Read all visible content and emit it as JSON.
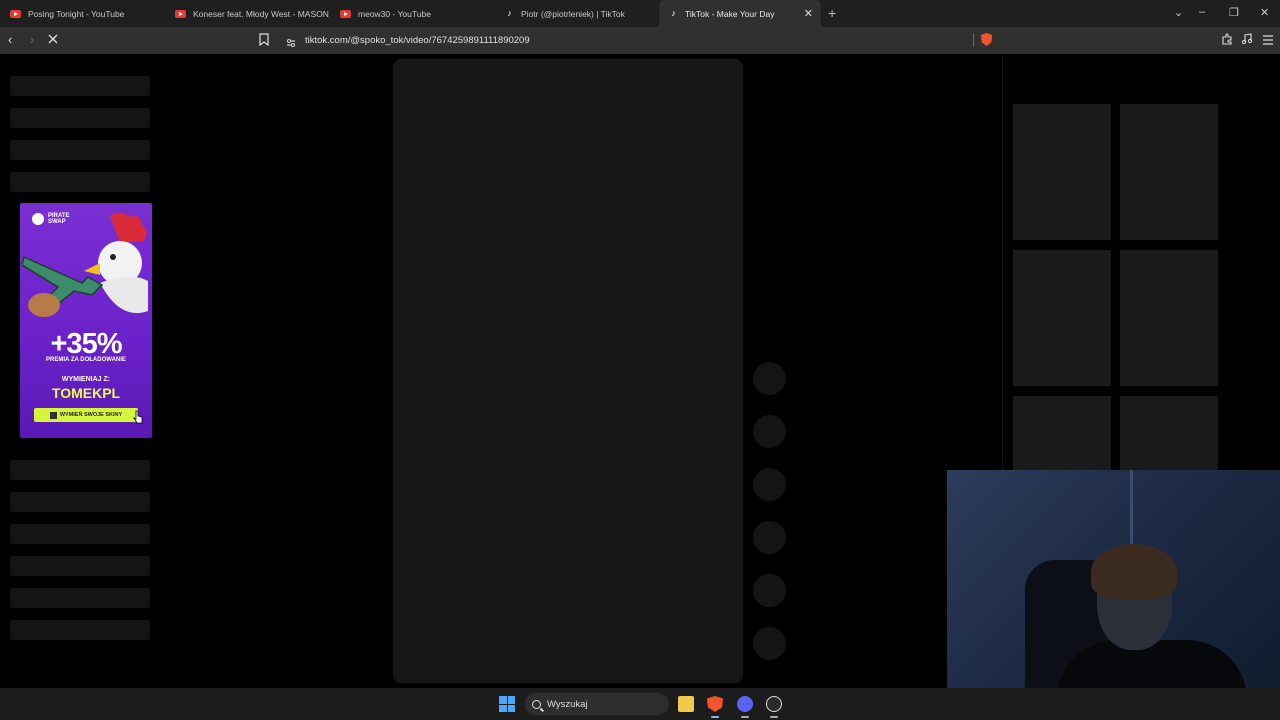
{
  "tabs": [
    {
      "title": "Posing Tonight - YouTube",
      "icon": "youtube-icon"
    },
    {
      "title": "Koneser feat. Młody West - MASON",
      "icon": "youtube-icon"
    },
    {
      "title": "meow30 - YouTube",
      "icon": "youtube-icon"
    },
    {
      "title": "Piotr (@piotrleniek) | TikTok",
      "icon": "tiktok-icon"
    },
    {
      "title": "TikTok - Make Your Day",
      "icon": "tiktok-icon",
      "active": true
    }
  ],
  "address_bar": {
    "url": "tiktok.com/@spoko_tok/video/7674259891111890209"
  },
  "ad": {
    "brand": "PIRATE SWAP",
    "headline": "+35%",
    "subline": "PREMIA ZA DOŁADOWANIE",
    "code_label": "WYMIENIAJ Z:",
    "code": "TOMEKPL",
    "cta": "WYMIEŃ SWOJE SKINY"
  },
  "taskbar": {
    "search_placeholder": "Wyszukaj"
  },
  "colors": {
    "page_bg": "#000000",
    "skeleton": "#141414",
    "ad_purple": "#6a21c9",
    "ad_accent": "#d4f53c",
    "brave_orange": "#f2542d"
  }
}
